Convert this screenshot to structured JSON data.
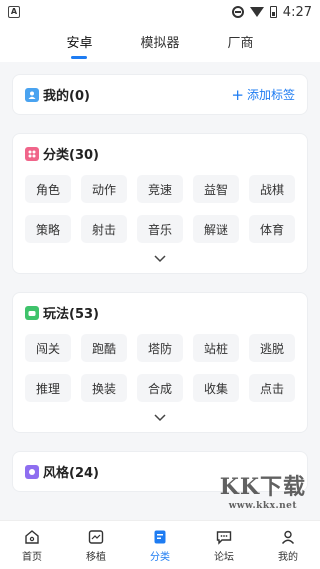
{
  "status": {
    "time": "4:27"
  },
  "top_tabs": [
    "安卓",
    "模拟器",
    "厂商"
  ],
  "my_card": {
    "title": "我的(0)",
    "add_label": "添加标签"
  },
  "category_card": {
    "title": "分类(30)",
    "tags": [
      "角色",
      "动作",
      "竞速",
      "益智",
      "战棋",
      "策略",
      "射击",
      "音乐",
      "解谜",
      "体育"
    ]
  },
  "gameplay_card": {
    "title": "玩法(53)",
    "tags": [
      "闯关",
      "跑酷",
      "塔防",
      "站桩",
      "逃脱",
      "推理",
      "换装",
      "合成",
      "收集",
      "点击"
    ]
  },
  "style_card": {
    "title": "风格(24)"
  },
  "bottom_nav": [
    "首页",
    "移植",
    "分类",
    "论坛",
    "我的"
  ],
  "watermark": {
    "text": "KK下载",
    "sub": "www.kkx.net"
  },
  "colors": {
    "accent": "#1e7cf2",
    "my_icon": "#4aa3f0",
    "category_icon": "#f0658a",
    "gameplay_icon": "#3fc36b",
    "style_icon": "#8e6ef0"
  }
}
